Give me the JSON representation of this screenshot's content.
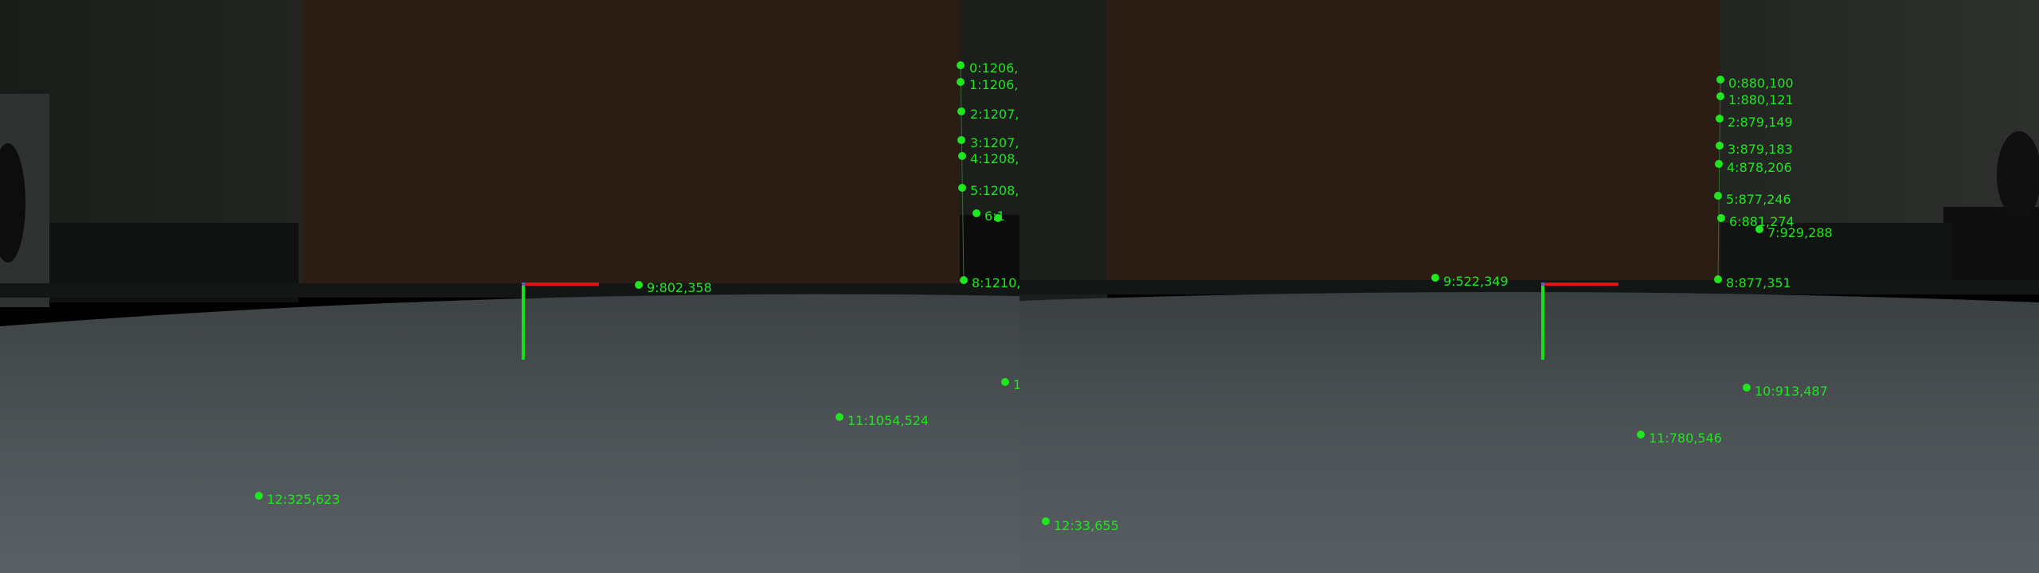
{
  "views": {
    "left": {
      "keypoint_labels": [
        "0:1206,",
        "1:1206,",
        "2:1207,",
        "3:1207,",
        "4:1208,",
        "5:1208,",
        "6:1",
        "8:1210,",
        "9:802,358",
        "1",
        "11:1054,524",
        "12:325,623"
      ]
    },
    "right": {
      "keypoint_labels": [
        "0:880,100",
        "1:880,121",
        "2:879,149",
        "3:879,183",
        "4:878,206",
        "5:877,246",
        "6:881,274",
        "7:929,288",
        "8:877,351",
        "9:522,349",
        "10:913,487",
        "11:780,546",
        "12:33,655"
      ]
    }
  },
  "colors": {
    "keypoint": "#1fe61f",
    "axis_x": "#e01414",
    "axis_y": "#18e018"
  }
}
